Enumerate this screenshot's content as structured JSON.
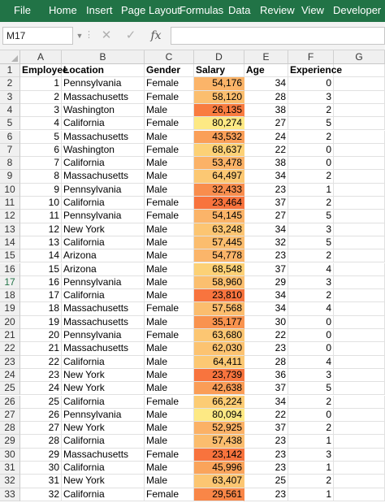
{
  "ribbon": {
    "tabs": [
      "File",
      "Home",
      "Insert",
      "Page Layout",
      "Formulas",
      "Data",
      "Review",
      "View",
      "Developer"
    ],
    "color": "#217346"
  },
  "formula_bar": {
    "name_box": "M17",
    "fx_label": "fx",
    "formula": "",
    "icons": [
      "dropdown-icon",
      "cancel-icon",
      "enter-icon",
      "insert-function-icon"
    ]
  },
  "sheet": {
    "columns": [
      "A",
      "B",
      "C",
      "D",
      "E",
      "F",
      "G"
    ],
    "headers": [
      "Employee",
      "Location",
      "Gender",
      "Salary",
      "Age",
      "Experience"
    ],
    "selected_row": 17,
    "salary_scale": {
      "min_color": "#fde984",
      "max_color": "#f8733d"
    },
    "rows": [
      {
        "n": "2",
        "id": "1",
        "loc": "Pennsylvania",
        "gender": "Female",
        "salary": "54,176",
        "age": "34",
        "exp": "0",
        "color": "#fbb469"
      },
      {
        "n": "3",
        "id": "2",
        "loc": "Massachusetts",
        "gender": "Female",
        "salary": "58,120",
        "age": "28",
        "exp": "3",
        "color": "#fbbe6e"
      },
      {
        "n": "4",
        "id": "3",
        "loc": "Washington",
        "gender": "Male",
        "salary": "26,135",
        "age": "38",
        "exp": "2",
        "color": "#f97c40"
      },
      {
        "n": "5",
        "id": "4",
        "loc": "California",
        "gender": "Female",
        "salary": "80,274",
        "age": "27",
        "exp": "5",
        "color": "#fde984"
      },
      {
        "n": "6",
        "id": "5",
        "loc": "Massachusetts",
        "gender": "Male",
        "salary": "43,532",
        "age": "24",
        "exp": "2",
        "color": "#fa9f58"
      },
      {
        "n": "7",
        "id": "6",
        "loc": "Washington",
        "gender": "Female",
        "salary": "68,637",
        "age": "22",
        "exp": "0",
        "color": "#fcd176"
      },
      {
        "n": "8",
        "id": "7",
        "loc": "California",
        "gender": "Male",
        "salary": "53,478",
        "age": "38",
        "exp": "0",
        "color": "#fbb267"
      },
      {
        "n": "9",
        "id": "8",
        "loc": "Massachusetts",
        "gender": "Male",
        "salary": "64,497",
        "age": "34",
        "exp": "2",
        "color": "#fcc873"
      },
      {
        "n": "10",
        "id": "9",
        "loc": "Pennsylvania",
        "gender": "Male",
        "salary": "32,433",
        "age": "23",
        "exp": "1",
        "color": "#f98d4d"
      },
      {
        "n": "11",
        "id": "10",
        "loc": "California",
        "gender": "Female",
        "salary": "23,464",
        "age": "37",
        "exp": "2",
        "color": "#f8733d"
      },
      {
        "n": "12",
        "id": "11",
        "loc": "Pennsylvania",
        "gender": "Female",
        "salary": "54,145",
        "age": "27",
        "exp": "5",
        "color": "#fbb469"
      },
      {
        "n": "13",
        "id": "12",
        "loc": "New York",
        "gender": "Male",
        "salary": "63,248",
        "age": "34",
        "exp": "3",
        "color": "#fcc572"
      },
      {
        "n": "14",
        "id": "13",
        "loc": "California",
        "gender": "Male",
        "salary": "57,445",
        "age": "32",
        "exp": "5",
        "color": "#fbbd6e"
      },
      {
        "n": "15",
        "id": "14",
        "loc": "Arizona",
        "gender": "Male",
        "salary": "54,778",
        "age": "23",
        "exp": "2",
        "color": "#fbb56a"
      },
      {
        "n": "16",
        "id": "15",
        "loc": "Arizona",
        "gender": "Male",
        "salary": "68,548",
        "age": "37",
        "exp": "4",
        "color": "#fcd176"
      },
      {
        "n": "17",
        "id": "16",
        "loc": "Pennsylvania",
        "gender": "Male",
        "salary": "58,960",
        "age": "29",
        "exp": "3",
        "color": "#fbbf6f"
      },
      {
        "n": "18",
        "id": "17",
        "loc": "California",
        "gender": "Male",
        "salary": "23,810",
        "age": "34",
        "exp": "2",
        "color": "#f8743e"
      },
      {
        "n": "19",
        "id": "18",
        "loc": "Massachusetts",
        "gender": "Female",
        "salary": "57,568",
        "age": "34",
        "exp": "4",
        "color": "#fbbd6e"
      },
      {
        "n": "20",
        "id": "19",
        "loc": "Massachusetts",
        "gender": "Male",
        "salary": "35,177",
        "age": "30",
        "exp": "0",
        "color": "#f9934f"
      },
      {
        "n": "21",
        "id": "20",
        "loc": "Pennsylvania",
        "gender": "Female",
        "salary": "63,680",
        "age": "22",
        "exp": "0",
        "color": "#fcc672"
      },
      {
        "n": "22",
        "id": "21",
        "loc": "Massachusetts",
        "gender": "Male",
        "salary": "62,030",
        "age": "23",
        "exp": "0",
        "color": "#fcc371"
      },
      {
        "n": "23",
        "id": "22",
        "loc": "California",
        "gender": "Male",
        "salary": "64,411",
        "age": "28",
        "exp": "4",
        "color": "#fcc873"
      },
      {
        "n": "24",
        "id": "23",
        "loc": "New York",
        "gender": "Male",
        "salary": "23,739",
        "age": "36",
        "exp": "3",
        "color": "#f8743e"
      },
      {
        "n": "25",
        "id": "24",
        "loc": "New York",
        "gender": "Male",
        "salary": "42,638",
        "age": "37",
        "exp": "5",
        "color": "#fa9d57"
      },
      {
        "n": "26",
        "id": "25",
        "loc": "California",
        "gender": "Female",
        "salary": "66,224",
        "age": "34",
        "exp": "2",
        "color": "#fccc74"
      },
      {
        "n": "27",
        "id": "26",
        "loc": "Pennsylvania",
        "gender": "Male",
        "salary": "80,094",
        "age": "22",
        "exp": "0",
        "color": "#fde984"
      },
      {
        "n": "28",
        "id": "27",
        "loc": "New York",
        "gender": "Male",
        "salary": "52,925",
        "age": "37",
        "exp": "2",
        "color": "#fbb166"
      },
      {
        "n": "29",
        "id": "28",
        "loc": "California",
        "gender": "Male",
        "salary": "57,438",
        "age": "23",
        "exp": "1",
        "color": "#fbbd6e"
      },
      {
        "n": "30",
        "id": "29",
        "loc": "Massachusetts",
        "gender": "Female",
        "salary": "23,142",
        "age": "23",
        "exp": "3",
        "color": "#f8733d"
      },
      {
        "n": "31",
        "id": "30",
        "loc": "California",
        "gender": "Male",
        "salary": "45,996",
        "age": "23",
        "exp": "1",
        "color": "#faa45b"
      },
      {
        "n": "32",
        "id": "31",
        "loc": "New York",
        "gender": "Male",
        "salary": "63,407",
        "age": "25",
        "exp": "2",
        "color": "#fcc672"
      },
      {
        "n": "33",
        "id": "32",
        "loc": "California",
        "gender": "Female",
        "salary": "29,561",
        "age": "23",
        "exp": "1",
        "color": "#f98647"
      }
    ]
  }
}
